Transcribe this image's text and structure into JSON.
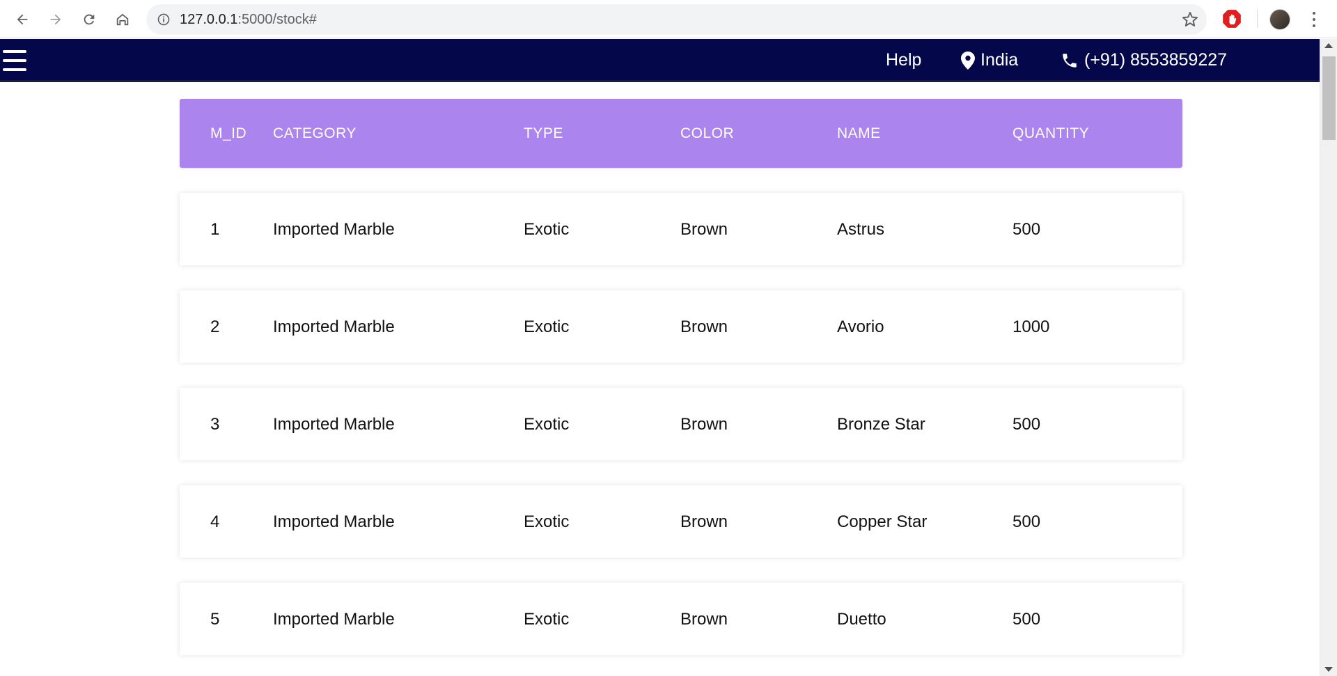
{
  "browser": {
    "url_host": "127.0.0.1",
    "url_path": ":5000/stock#"
  },
  "header": {
    "help_label": "Help",
    "location_label": "India",
    "phone_label": "(+91) 8553859227",
    "bg_color": "#04074a"
  },
  "table": {
    "header_color": "#ac84ed",
    "columns": [
      "M_ID",
      "CATEGORY",
      "TYPE",
      "COLOR",
      "NAME",
      "QUANTITY"
    ],
    "rows": [
      {
        "m_id": "1",
        "category": "Imported Marble",
        "type": "Exotic",
        "color": "Brown",
        "name": "Astrus",
        "quantity": "500"
      },
      {
        "m_id": "2",
        "category": "Imported Marble",
        "type": "Exotic",
        "color": "Brown",
        "name": "Avorio",
        "quantity": "1000"
      },
      {
        "m_id": "3",
        "category": "Imported Marble",
        "type": "Exotic",
        "color": "Brown",
        "name": "Bronze Star",
        "quantity": "500"
      },
      {
        "m_id": "4",
        "category": "Imported Marble",
        "type": "Exotic",
        "color": "Brown",
        "name": "Copper Star",
        "quantity": "500"
      },
      {
        "m_id": "5",
        "category": "Imported Marble",
        "type": "Exotic",
        "color": "Brown",
        "name": "Duetto",
        "quantity": "500"
      }
    ]
  }
}
